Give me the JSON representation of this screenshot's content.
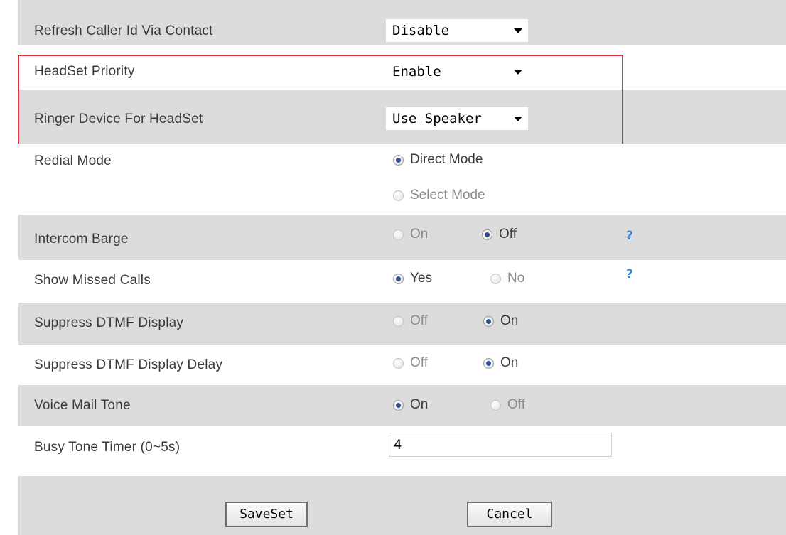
{
  "settings": {
    "refresh_caller_id": {
      "label": "Refresh Caller Id Via Contact",
      "value": "Disable"
    },
    "headset_priority": {
      "label": "HeadSet Priority",
      "value": "Enable"
    },
    "ringer_device": {
      "label": "Ringer Device For HeadSet",
      "value": "Use Speaker"
    },
    "redial_mode": {
      "label": "Redial Mode",
      "option1": "Direct Mode",
      "option2": "Select Mode",
      "selected": "Direct Mode"
    },
    "intercom_barge": {
      "label": "Intercom Barge",
      "option1": "On",
      "option2": "Off",
      "selected": "Off",
      "help": "?"
    },
    "show_missed_calls": {
      "label": "Show Missed Calls",
      "option1": "Yes",
      "option2": "No",
      "selected": "Yes",
      "help": "?"
    },
    "suppress_dtmf": {
      "label": "Suppress DTMF Display",
      "option1": "Off",
      "option2": "On",
      "selected": "On"
    },
    "suppress_dtmf_delay": {
      "label": "Suppress DTMF Display Delay",
      "option1": "Off",
      "option2": "On",
      "selected": "On"
    },
    "voice_mail_tone": {
      "label": "Voice Mail Tone",
      "option1": "On",
      "option2": "Off",
      "selected": "On"
    },
    "busy_tone_timer": {
      "label": "Busy Tone Timer (0~5s)",
      "value": "4"
    }
  },
  "buttons": {
    "save": "SaveSet",
    "cancel": "Cancel"
  },
  "colors": {
    "row_gray": "#dcdcdc",
    "highlight": "#e0303a",
    "radio_checked": "#2d4f8f",
    "help": "#3d8ad8"
  },
  "icons": {
    "help": "question-mark-icon"
  }
}
